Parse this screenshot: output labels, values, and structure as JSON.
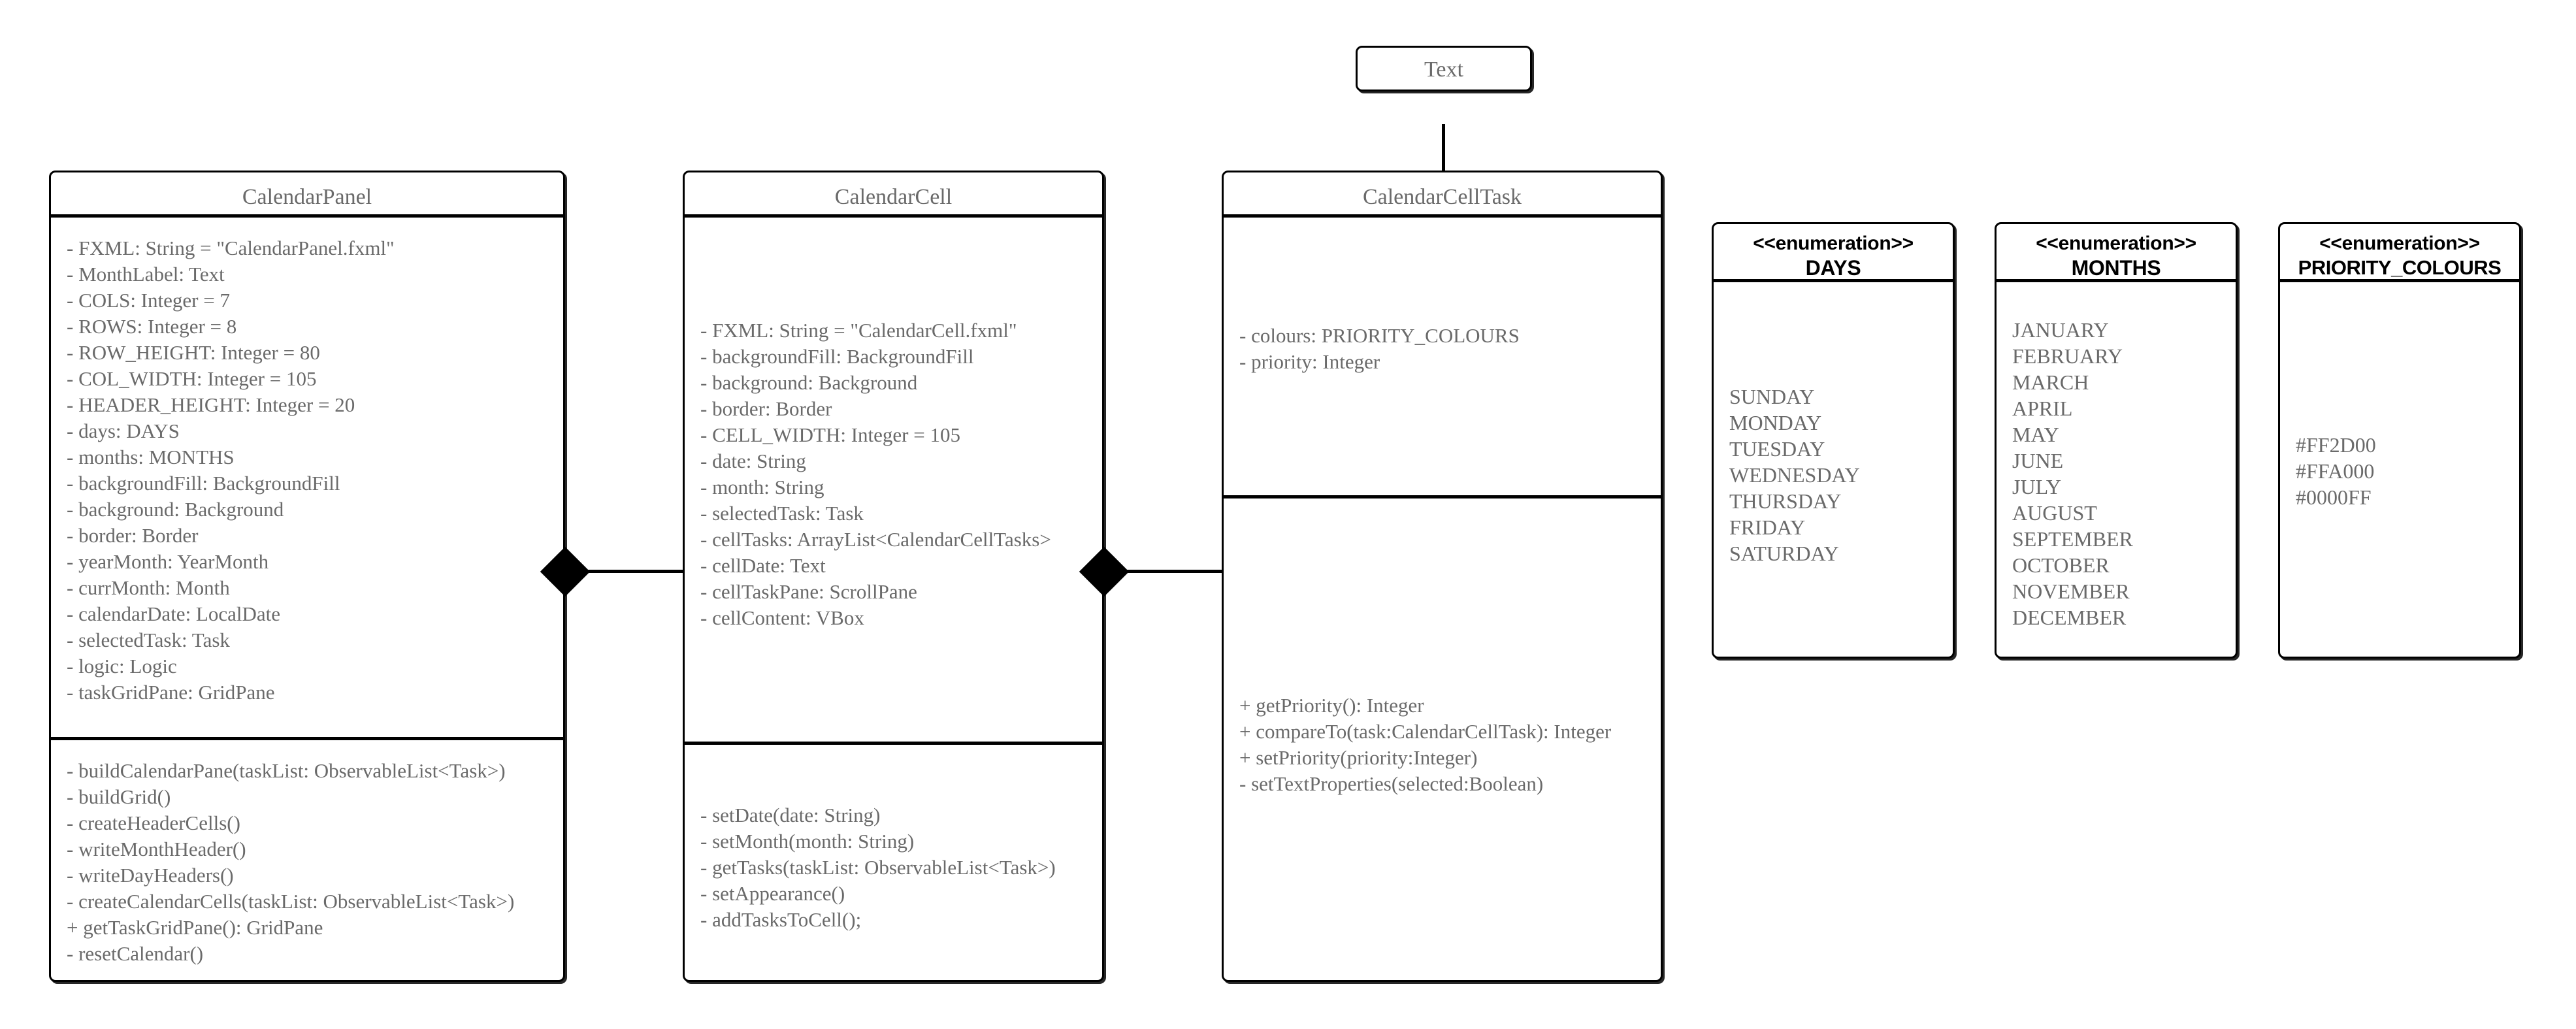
{
  "diagram": {
    "type": "uml-class-diagram",
    "classes": [
      {
        "id": "calendar-panel",
        "name": "CalendarPanel",
        "attributes": [
          "- FXML: String = \"CalendarPanel.fxml\"",
          "- MonthLabel: Text",
          "- COLS: Integer = 7",
          "- ROWS: Integer = 8",
          "- ROW_HEIGHT: Integer = 80",
          "- COL_WIDTH: Integer = 105",
          "- HEADER_HEIGHT: Integer = 20",
          "- days: DAYS",
          "- months: MONTHS",
          "- backgroundFill: BackgroundFill",
          "- background: Background",
          "- border: Border",
          "- yearMonth: YearMonth",
          "- currMonth: Month",
          "- calendarDate: LocalDate",
          "- selectedTask: Task",
          "- logic: Logic",
          "- taskGridPane: GridPane"
        ],
        "methods": [
          "- buildCalendarPane(taskList: ObservableList<Task>)",
          "- buildGrid()",
          "- createHeaderCells()",
          "- writeMonthHeader()",
          "- writeDayHeaders()",
          "- createCalendarCells(taskList: ObservableList<Task>)",
          "+ getTaskGridPane(): GridPane",
          "- resetCalendar()"
        ]
      },
      {
        "id": "calendar-cell",
        "name": "CalendarCell",
        "attributes": [
          "- FXML: String = \"CalendarCell.fxml\"",
          "- backgroundFill: BackgroundFill",
          "- background: Background",
          "- border: Border",
          "- CELL_WIDTH: Integer = 105",
          "- date: String",
          "- month: String",
          "- selectedTask: Task",
          "- cellTasks: ArrayList<CalendarCellTasks>",
          "- cellDate: Text",
          "- cellTaskPane: ScrollPane",
          "- cellContent: VBox"
        ],
        "methods": [
          "- setDate(date: String)",
          "- setMonth(month: String)",
          "- getTasks(taskList: ObservableList<Task>)",
          "- setAppearance()",
          "- addTasksToCell();"
        ]
      },
      {
        "id": "calendar-cell-task",
        "name": "CalendarCellTask",
        "attributes": [
          "- colours: PRIORITY_COLOURS",
          "- priority: Integer"
        ],
        "methods": [
          "+ getPriority(): Integer",
          "+ compareTo(task:CalendarCellTask): Integer",
          "+ setPriority(priority:Integer)",
          "- setTextProperties(selected:Boolean)"
        ]
      }
    ],
    "superclass": {
      "id": "text-class",
      "name": "Text"
    },
    "enumerations": [
      {
        "id": "days-enum",
        "stereotype": "<<enumeration>>",
        "name": "DAYS",
        "values": [
          "SUNDAY",
          "MONDAY",
          "TUESDAY",
          "WEDNESDAY",
          "THURSDAY",
          "FRIDAY",
          "SATURDAY"
        ]
      },
      {
        "id": "months-enum",
        "stereotype": "<<enumeration>>",
        "name": "MONTHS",
        "values": [
          "JANUARY",
          "FEBRUARY",
          "MARCH",
          "APRIL",
          "MAY",
          "JUNE",
          "JULY",
          "AUGUST",
          "SEPTEMBER",
          "OCTOBER",
          "NOVEMBER",
          "DECEMBER"
        ]
      },
      {
        "id": "priority-colours-enum",
        "stereotype": "<<enumeration>>",
        "name": "PRIORITY_COLOURS",
        "values": [
          "#FF2D00",
          "#FFA000",
          "#0000FF"
        ]
      }
    ],
    "relationships": [
      {
        "id": "panel-cell-composition",
        "kind": "composition",
        "from": "CalendarPanel",
        "to": "CalendarCell"
      },
      {
        "id": "cell-task-composition",
        "kind": "composition",
        "from": "CalendarCell",
        "to": "CalendarCellTask"
      },
      {
        "id": "task-text-generalization",
        "kind": "generalization",
        "from": "CalendarCellTask",
        "to": "Text"
      }
    ]
  },
  "colors": {
    "stroke": "#000000",
    "text": "#6a6a6a",
    "heading": "#000000",
    "background": "#ffffff"
  }
}
